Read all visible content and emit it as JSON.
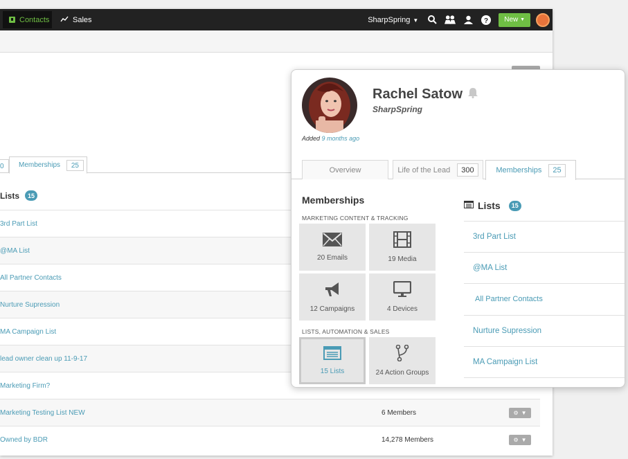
{
  "topnav": {
    "contacts_label": "Contacts",
    "sales_label": "Sales",
    "account_label": "SharpSpring",
    "new_label": "New"
  },
  "background": {
    "tab_cut_count": "0",
    "tab_label": "Memberships",
    "tab_count": "25",
    "lists_title": "Lists",
    "lists_count": "15",
    "rows": [
      {
        "name": "3rd Part List",
        "members": ""
      },
      {
        "name": "@MA List",
        "members": ""
      },
      {
        "name": "All Partner Contacts",
        "members": ""
      },
      {
        "name": "Nurture Supression",
        "members": ""
      },
      {
        "name": "MA Campaign List",
        "members": ""
      },
      {
        "name": "lead owner clean up 11-9-17",
        "members": ""
      },
      {
        "name": "Marketing Firm?",
        "members": ""
      },
      {
        "name": "Marketing Testing List NEW",
        "members": "6 Members"
      },
      {
        "name": "Owned by BDR",
        "members": "14,278 Members"
      }
    ]
  },
  "card": {
    "name": "Rachel Satow",
    "company": "SharpSpring",
    "added_prefix": "Added",
    "added_ago": "9 months ago",
    "tabs": [
      {
        "label": "Overview",
        "count": ""
      },
      {
        "label": "Life of the Lead",
        "count": "300"
      },
      {
        "label": "Memberships",
        "count": "25"
      }
    ],
    "memberships_title": "Memberships",
    "section1": "MARKETING CONTENT & TRACKING",
    "section2": "LISTS, AUTOMATION & SALES",
    "tiles": [
      {
        "label": "20 Emails",
        "icon": "envelope-icon"
      },
      {
        "label": "19 Media",
        "icon": "film-icon"
      },
      {
        "label": "12 Campaigns",
        "icon": "megaphone-icon"
      },
      {
        "label": "4 Devices",
        "icon": "monitor-icon"
      },
      {
        "label": "15 Lists",
        "icon": "list-icon"
      },
      {
        "label": "24 Action Groups",
        "icon": "branch-icon"
      }
    ],
    "lists_title": "Lists",
    "lists_count": "15",
    "lists": [
      "3rd Part List",
      "@MA List",
      "All Partner Contacts",
      "Nurture Supression",
      "MA Campaign List"
    ]
  }
}
